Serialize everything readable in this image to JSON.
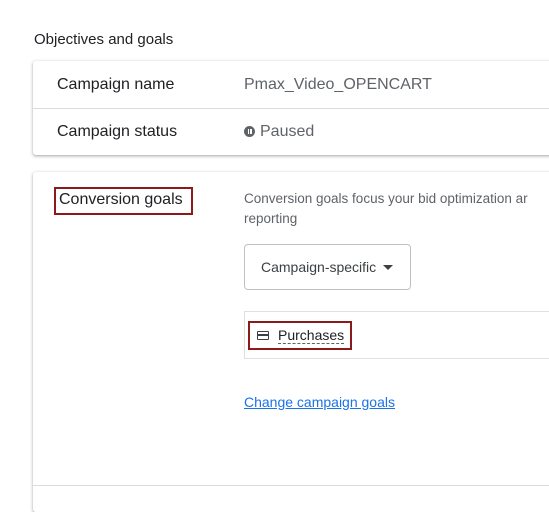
{
  "section": {
    "title": "Objectives and goals"
  },
  "campaign": {
    "name_label": "Campaign name",
    "name_value": "Pmax_Video_OPENCART",
    "status_label": "Campaign status",
    "status_value": "Paused",
    "status_icon": "pause-circle-icon"
  },
  "conversion": {
    "label": "Conversion goals",
    "description_line1": "Conversion goals focus your bid optimization ar",
    "description_line2": "reporting",
    "dropdown_value": "Campaign-specific",
    "goal_icon": "credit-card-icon",
    "goal_name": "Purchases",
    "change_link": "Change campaign goals"
  },
  "colors": {
    "highlight_border": "#8b1a1a",
    "link": "#1a73e8"
  }
}
